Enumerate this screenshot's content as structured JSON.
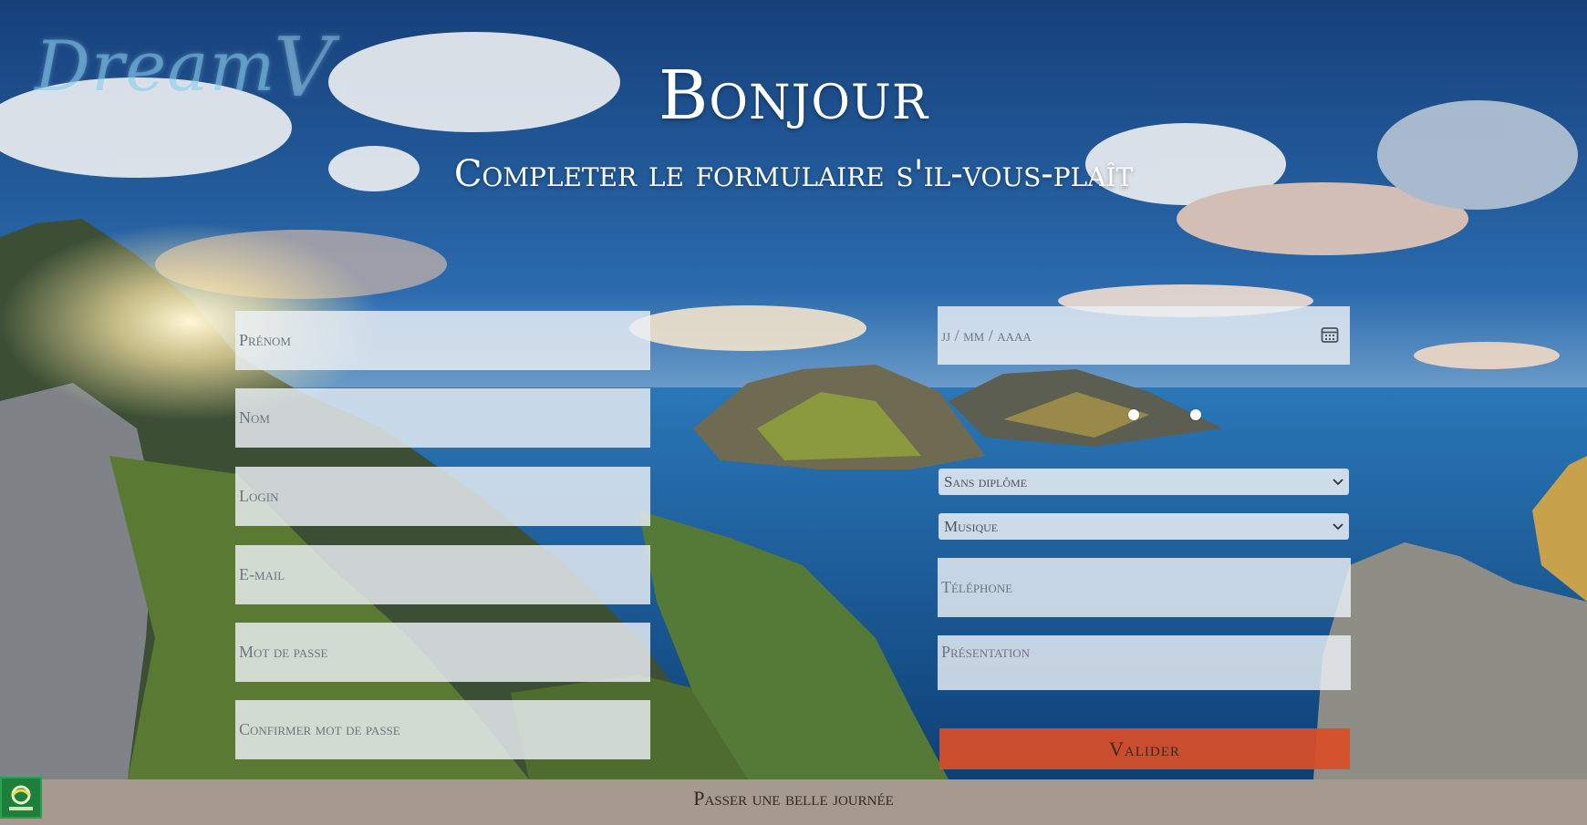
{
  "header": {
    "logo_text": "Dream",
    "logo_flourish": "V",
    "title": "Bonjour",
    "subtitle": "Completer le formulaire s'il-vous-plaît"
  },
  "form": {
    "left": {
      "prenom_placeholder": "Prénom",
      "nom_placeholder": "Nom",
      "login_placeholder": "Login",
      "email_placeholder": "E-mail",
      "password_placeholder": "Mot de passe",
      "confirm_password_placeholder": "Confirmer mot de passe"
    },
    "right": {
      "date_placeholder": "jj / mm / aaaa",
      "diplome_selected": "Sans diplôme",
      "domaine_selected": "Musique",
      "telephone_placeholder": "Téléphone",
      "presentation_placeholder": "Présentation",
      "submit_label": "Valider"
    }
  },
  "footer": {
    "text": "Passer une belle journée"
  },
  "colors": {
    "submit": "#da4e28",
    "footer": "#a6998f",
    "field_bg": "#ecf0f5"
  }
}
